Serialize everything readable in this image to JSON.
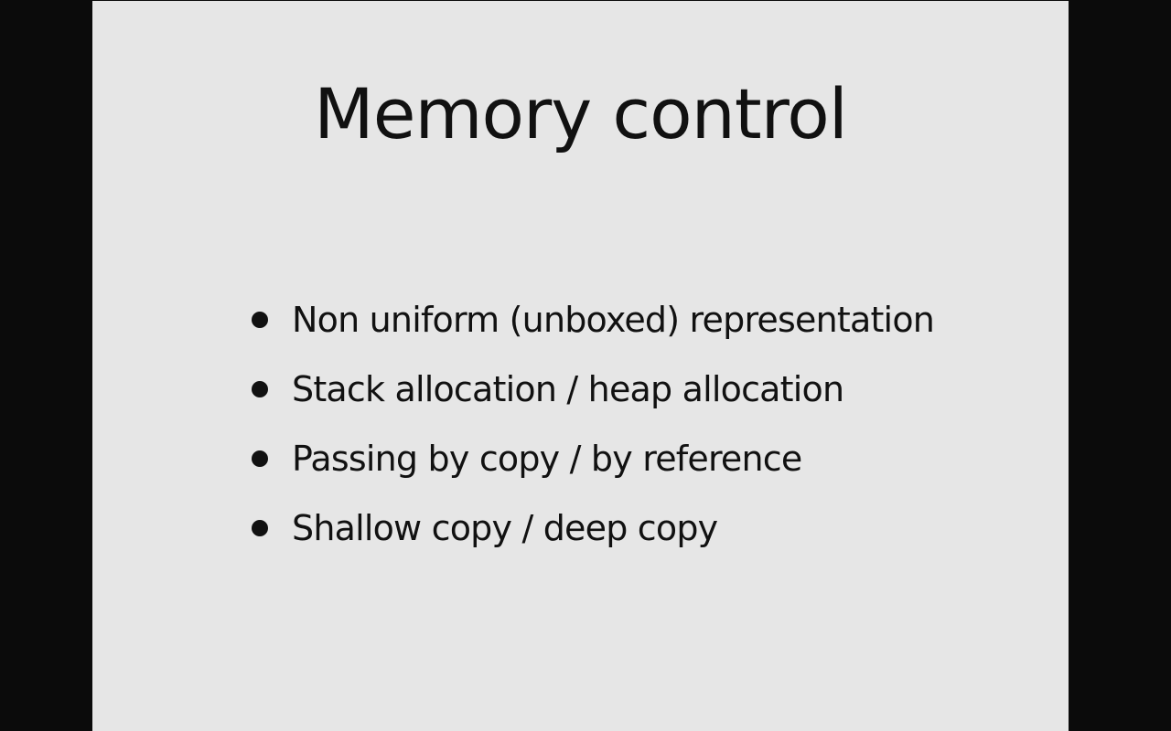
{
  "slide": {
    "title": "Memory control",
    "bullets": [
      {
        "text": "Non uniform (unboxed) representation"
      },
      {
        "text": "Stack allocation / heap allocation"
      },
      {
        "text": "Passing by copy / by reference"
      },
      {
        "text": "Shallow copy / deep copy"
      }
    ]
  },
  "colors": {
    "letterbox": "#0b0b0b",
    "slide_background": "#e6e6e6",
    "text": "#111111"
  }
}
